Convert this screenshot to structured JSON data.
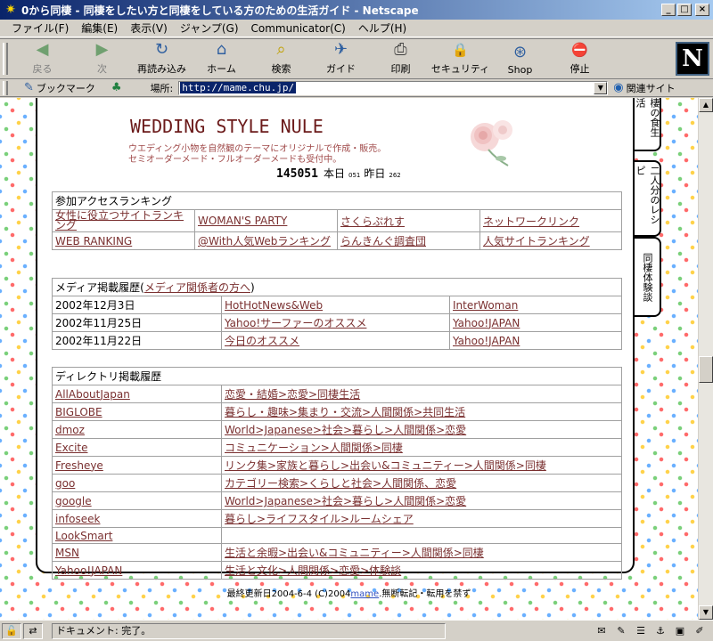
{
  "window": {
    "title": "0から同棲 - 同棲をしたい方と同棲をしている方のための生活ガイド - Netscape",
    "min_label": "_",
    "max_label": "□",
    "close_label": "×"
  },
  "menu": [
    "ファイル(F)",
    "編集(E)",
    "表示(V)",
    "ジャンプ(G)",
    "Communicator(C)",
    "ヘルプ(H)"
  ],
  "toolbar": [
    {
      "label": "戻る",
      "icon": "back-arrow-icon",
      "glyph": "◀",
      "disabled": true
    },
    {
      "label": "次",
      "icon": "forward-arrow-icon",
      "glyph": "▶",
      "disabled": true
    },
    {
      "label": "再読み込み",
      "icon": "reload-icon",
      "glyph": "↻",
      "disabled": false
    },
    {
      "label": "ホーム",
      "icon": "home-icon",
      "glyph": "⌂",
      "disabled": false
    },
    {
      "label": "検索",
      "icon": "search-icon",
      "glyph": "⌕",
      "disabled": false
    },
    {
      "label": "ガイド",
      "icon": "guide-icon",
      "glyph": "✈",
      "disabled": false
    },
    {
      "label": "印刷",
      "icon": "printer-icon",
      "glyph": "⎙",
      "disabled": false
    },
    {
      "label": "セキュリティ",
      "icon": "lock-icon",
      "glyph": "🔒",
      "disabled": false
    },
    {
      "label": "Shop",
      "icon": "shop-icon",
      "glyph": "⊛",
      "disabled": false
    },
    {
      "label": "停止",
      "icon": "stop-icon",
      "glyph": "⛔",
      "disabled": false
    }
  ],
  "logo_letter": "N",
  "location": {
    "bookmark_label": "ブックマーク",
    "location_label": "場所:",
    "url": "http://mame.chu.jp/",
    "related_label": "関連サイト"
  },
  "header": {
    "brand_title": "WEDDING STYLE NULE",
    "brand_line1": "ウエディング小物を自然観のテーマにオリジナルで作成・販売。",
    "brand_line2": "セミオーダーメード・フルオーダーメードも受付中。",
    "counter_total": "145051",
    "today_label": "本日",
    "today_count": "051",
    "yesterday_label": "昨日",
    "yesterday_count": "262"
  },
  "sidetabs": [
    "棲の食生活",
    "二人分のレシピ",
    "同棲体験談"
  ],
  "ranking": {
    "title": "参加アクセスランキング",
    "rows": [
      [
        "女性に役立つサイトランキング",
        "WOMAN'S PARTY",
        "さくらぷれす",
        "ネットワークリンク"
      ],
      [
        "WEB RANKING",
        "@With人気Webランキング",
        "らんきんぐ調査団",
        "人気サイトランキング"
      ]
    ]
  },
  "media": {
    "title_prefix": "メディア掲載履歴(",
    "title_link": "メディア関係者の方へ",
    "title_suffix": ")",
    "rows": [
      {
        "date": "2002年12月3日",
        "site": "HotHotNews&Web",
        "source": "InterWoman"
      },
      {
        "date": "2002年11月25日",
        "site": "Yahoo!サーファーのオススメ",
        "source": "Yahoo!JAPAN"
      },
      {
        "date": "2002年11月22日",
        "site": "今日のオススメ",
        "source": "Yahoo!JAPAN"
      }
    ]
  },
  "directory": {
    "title": "ディレクトリ掲載履歴",
    "rows": [
      {
        "name": "AllAboutJapan",
        "path": "恋愛・結婚>恋愛>同棲生活"
      },
      {
        "name": "BIGLOBE",
        "path": "暮らし・趣味>集まり・交流>人間関係>共同生活"
      },
      {
        "name": "dmoz",
        "path": "World>Japanese>社会>暮らし>人間関係>恋愛"
      },
      {
        "name": "Excite",
        "path": "コミュニケーション>人間関係>同棲"
      },
      {
        "name": "Fresheye",
        "path": "リンク集>家族と暮らし>出会い&コミュニティー>人間関係>同棲"
      },
      {
        "name": "goo",
        "path": "カテゴリー検索>くらしと社会>人間関係、恋愛"
      },
      {
        "name": "google",
        "path": "World>Japanese>社会>暮らし>人間関係>恋愛"
      },
      {
        "name": "infoseek",
        "path": "暮らし>ライフスタイル>ルームシェア"
      },
      {
        "name": "LookSmart",
        "path": ""
      },
      {
        "name": "MSN",
        "path": "生活と余暇>出会い&コミュニティー>人間関係>同棲"
      },
      {
        "name": "Yahoo!JAPAN",
        "path": "生活と文化>人間関係>恋愛>体験談"
      }
    ]
  },
  "footer": {
    "prefix": "最終更新日2004-6-4 (C)2004",
    "link": "mame",
    "suffix": ".無断転記・転用を禁ず"
  },
  "status": {
    "text": "ドキュメント: 完了。"
  },
  "colors": {
    "link": "#7a3030",
    "brand": "#6b1a1a",
    "titlebar": "#0a246a"
  }
}
